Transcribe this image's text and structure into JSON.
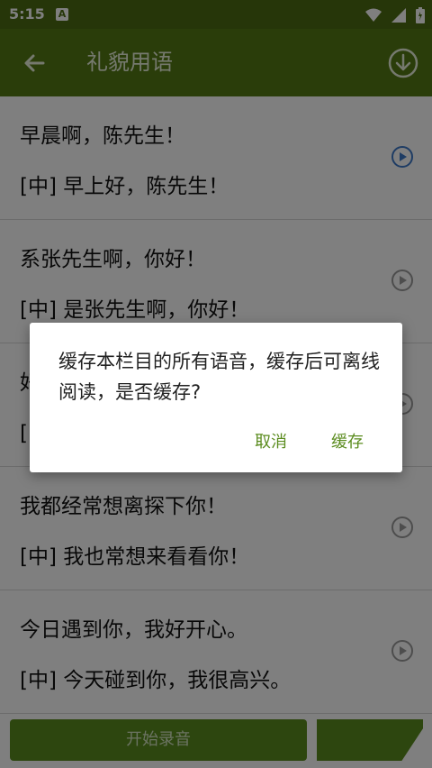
{
  "status_bar": {
    "time": "5:15",
    "notification_icon": "A"
  },
  "app_bar": {
    "title": "礼貌用语",
    "back_icon": "arrow-left-icon",
    "download_icon": "download-circle-icon"
  },
  "phrases": [
    {
      "original": "早晨啊，陈先生！",
      "translation": "[中] 早上好，陈先生！",
      "playing": true
    },
    {
      "original": "系张先生啊，你好！",
      "translation": "[中] 是张先生啊，你好！",
      "playing": false
    },
    {
      "original": "好",
      "translation": "[中",
      "playing": false
    },
    {
      "original": "我都经常想离探下你！",
      "translation": "[中] 我也常想来看看你！",
      "playing": false
    },
    {
      "original": "今日遇到你，我好开心。",
      "translation": "[中] 今天碰到你，我很高兴。",
      "playing": false
    }
  ],
  "bottom": {
    "record_label": "开始录音"
  },
  "dialog": {
    "message": "缓存本栏目的所有语音，缓存后可离线阅读，是否缓存?",
    "cancel_label": "取消",
    "confirm_label": "缓存"
  },
  "colors": {
    "status_bar": "#4d6d12",
    "app_bar": "#557a14",
    "accent": "#5b8c1f",
    "play_active": "#3d78c8",
    "play_inactive": "#9a9a9a"
  }
}
